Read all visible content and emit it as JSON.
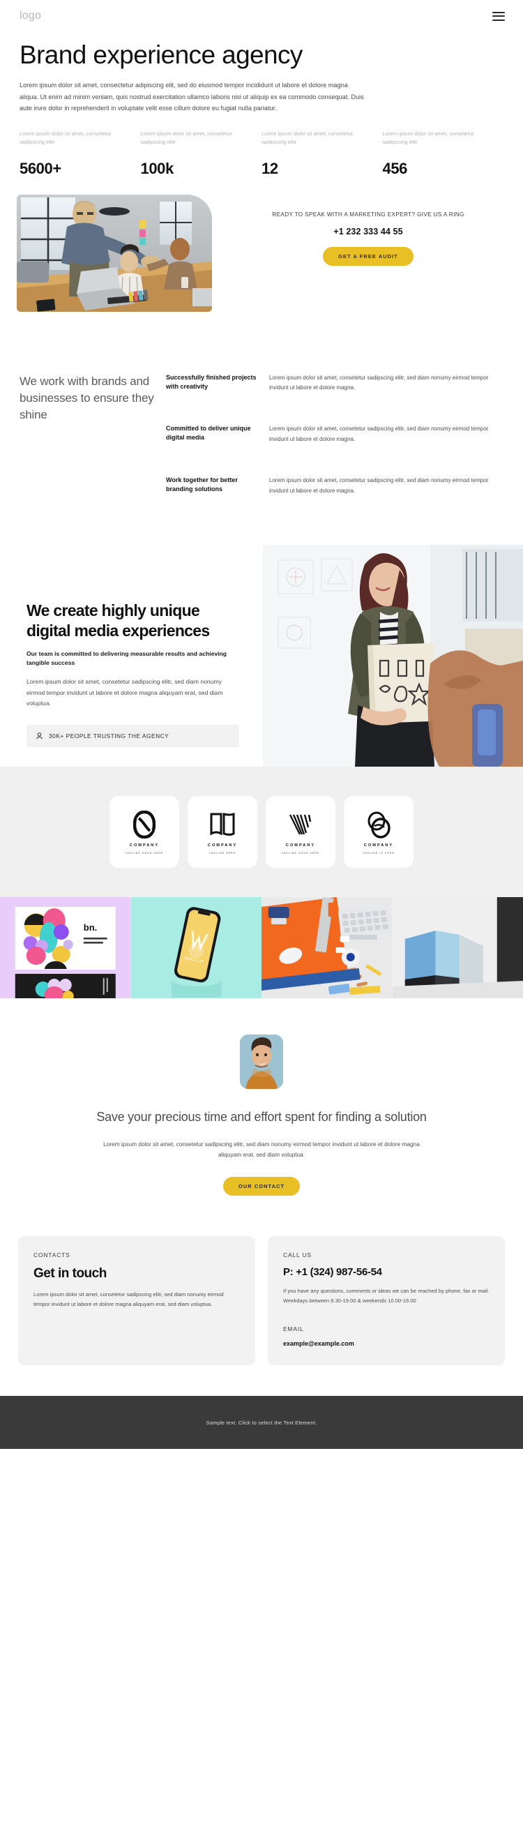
{
  "header": {
    "logo": "logo",
    "menu_icon": "hamburger-menu-icon"
  },
  "hero": {
    "title": "Brand experience agency",
    "paragraph": "Lorem ipsum dolor sit amet, consectetur adipiscing elit, sed do eiusmod tempor incididunt ut labore et dolore magna aliqua. Ut enim ad minim veniam, quis nostrud exercitation ullamco laboris nisi ut aliquip ex ea commodo consequat. Duis aute irure dolor in reprehenderit in voluptate velit esse cillum dolore eu fugiat nulla pariatur."
  },
  "stats": [
    {
      "label": "Lorem ipsum dolor sit amet, consetetur sadipscing elitr",
      "value": "5600+"
    },
    {
      "label": "Lorem ipsum dolor sit amet, consetetur sadipscing elitr",
      "value": "100k"
    },
    {
      "label": "Lorem ipsum dolor sit amet, consetetur sadipscing elitr",
      "value": "12"
    },
    {
      "label": "Lorem ipsum dolor sit amet, consetetur sadipscing elitr",
      "value": "456"
    }
  ],
  "hero_cta": {
    "title": "READY TO SPEAK WITH A MARKETING EXPERT? GIVE US A RING",
    "phone": "+1 232 333 44 55",
    "button": "GET A FREE AUDIT"
  },
  "work_with": {
    "title": "We work with brands and businesses to ensure they shine",
    "rows": [
      {
        "heading": "Successfully finished projects with creativity",
        "text": "Lorem ipsum dolor sit amet, consetetur sadipscing elitr, sed diam nonumy eirmod tempor invidunt ut labore et dolore magna."
      },
      {
        "heading": "Committed to deliver unique digital media",
        "text": "Lorem ipsum dolor sit amet, consetetur sadipscing elitr, sed diam nonumy eirmod tempor invidunt ut labore et dolore magna."
      },
      {
        "heading": "Work together for better branding solutions",
        "text": "Lorem ipsum dolor sit amet, consetetur sadipscing elitr, sed diam nonumy eirmod tempor invidunt ut labore et dolore magna."
      }
    ]
  },
  "create": {
    "title": "We create highly unique digital media experiences",
    "lead": "Our team is committed to delivering measurable results and achieving tangible success",
    "paragraph": "Lorem ipsum dolor sit amet, consetetur sadipscing elitr, sed diam nonumy eirmod tempor invidunt ut labore et dolore magna aliquyam erat, sed diam voluptua.",
    "trust_badge": "30K+ PEOPLE TRUSTING THE AGENCY",
    "trust_icon": "user-icon"
  },
  "logo_cards": [
    {
      "name": "COMPANY",
      "tagline": "TAGLINE GOES HERE",
      "mark": "infinity-loop-mark"
    },
    {
      "name": "COMPANY",
      "tagline": "TAGLINE HERE",
      "mark": "open-book-mark"
    },
    {
      "name": "COMPANY",
      "tagline": "TAGLINE GOES HERE",
      "mark": "striped-v-mark"
    },
    {
      "name": "COMPANY",
      "tagline": "TAGLINE IS HERE",
      "mark": "overlapping-ellipse-mark"
    }
  ],
  "gallery": [
    {
      "name": "branding-identity-card-artwork"
    },
    {
      "name": "phone-mockup-on-pedestal"
    },
    {
      "name": "orange-desk-stationery-flatlay"
    },
    {
      "name": "blue-paper-cards-mockup"
    }
  ],
  "testimonial": {
    "avatar": "person-portrait-avatar",
    "title": "Save your precious time and effort spent for finding a solution",
    "paragraph": "Lorem ipsum dolor sit amet, consetetur sadipscing elitr, sed diam nonumy eirmod tempor invidunt ut labore et dolore magna aliquyam erat, sed diam voluptua.",
    "button": "OUR CONTACT"
  },
  "contact_cards": {
    "left": {
      "eyebrow": "CONTACTS",
      "title": "Get in touch",
      "paragraph": "Lorem ipsum dolor sit amet, consetetur sadipscing elitr, sed diam nonumy eirmod tempor invidunt ut labore et dolore magna aliquyam erat, sed diam voluptua."
    },
    "right": {
      "eyebrow": "CALL US",
      "phone": "P: +1 (324) 987-56-54",
      "paragraph": "If you have any questions, comments or ideas we can be reached by phone, fax or mail. Weekdays between 8.30-19.00 & weekends 10.00-19.00",
      "email_eyebrow": "EMAIL",
      "email": "example@example.com"
    }
  },
  "footer": {
    "text": "Sample text. Click to select the Text Element."
  },
  "colors": {
    "accent_yellow": "#e8bf24",
    "panel_grey": "#f0f0f0",
    "footer_dark": "#3a3a3a"
  }
}
